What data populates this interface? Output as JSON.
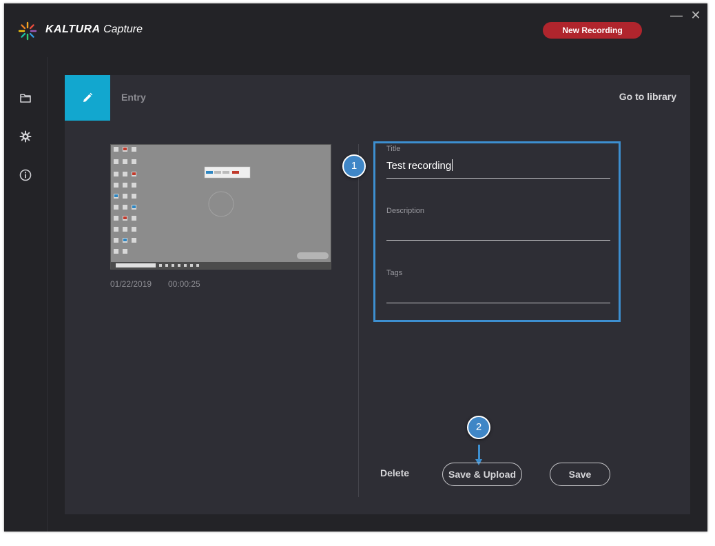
{
  "app": {
    "brand_bold": "KALTURA",
    "brand_light": "Capture"
  },
  "header": {
    "new_recording_label": "New Recording",
    "minimize_glyph": "—",
    "close_glyph": "✕"
  },
  "sidebar": {
    "items": [
      {
        "icon": "folder-icon"
      },
      {
        "icon": "gear-icon"
      },
      {
        "icon": "info-icon"
      }
    ]
  },
  "entry": {
    "tab_label": "Entry",
    "go_to_library_label": "Go to library",
    "date": "01/22/2019",
    "duration": "00:00:25"
  },
  "form": {
    "title_label": "Title",
    "title_value": "Test recording",
    "description_label": "Description",
    "description_value": "",
    "tags_label": "Tags",
    "tags_value": ""
  },
  "actions": {
    "delete_label": "Delete",
    "save_upload_label": "Save & Upload",
    "save_label": "Save"
  },
  "annotations": {
    "callout_1": "1",
    "callout_2": "2"
  },
  "colors": {
    "accent": "#12a7cf",
    "record": "#b0252d",
    "annotation": "#3d8fd0",
    "background": "#232327",
    "panel": "#2e2e35"
  }
}
